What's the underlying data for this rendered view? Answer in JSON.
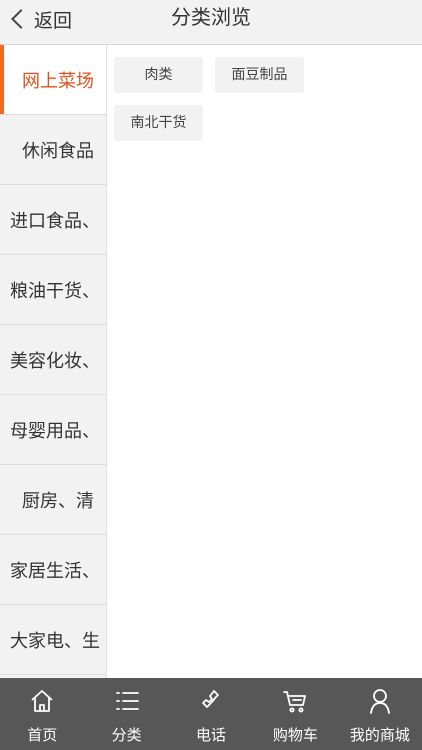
{
  "header": {
    "back_label": "返回",
    "title": "分类浏览"
  },
  "sidebar": {
    "active_index": 0,
    "items": [
      {
        "label": "网上菜场"
      },
      {
        "label": "休闲食品"
      },
      {
        "label": "进口食品、"
      },
      {
        "label": "粮油干货、"
      },
      {
        "label": "美容化妆、"
      },
      {
        "label": "母婴用品、"
      },
      {
        "label": "厨房、清"
      },
      {
        "label": "家居生活、"
      },
      {
        "label": "大家电、生"
      }
    ]
  },
  "content": {
    "subcategories": [
      {
        "label": "肉类"
      },
      {
        "label": "面豆制品"
      },
      {
        "label": "南北干货"
      }
    ]
  },
  "tabbar": {
    "items": [
      {
        "label": "首页",
        "icon": "home-icon"
      },
      {
        "label": "分类",
        "icon": "list-icon"
      },
      {
        "label": "电话",
        "icon": "phone-icon"
      },
      {
        "label": "购物车",
        "icon": "cart-icon"
      },
      {
        "label": "我的商城",
        "icon": "user-icon"
      }
    ]
  },
  "colors": {
    "accent": "#e0531f",
    "tabbar_bg": "#575757",
    "sidebar_bg": "#f2f2f2"
  }
}
